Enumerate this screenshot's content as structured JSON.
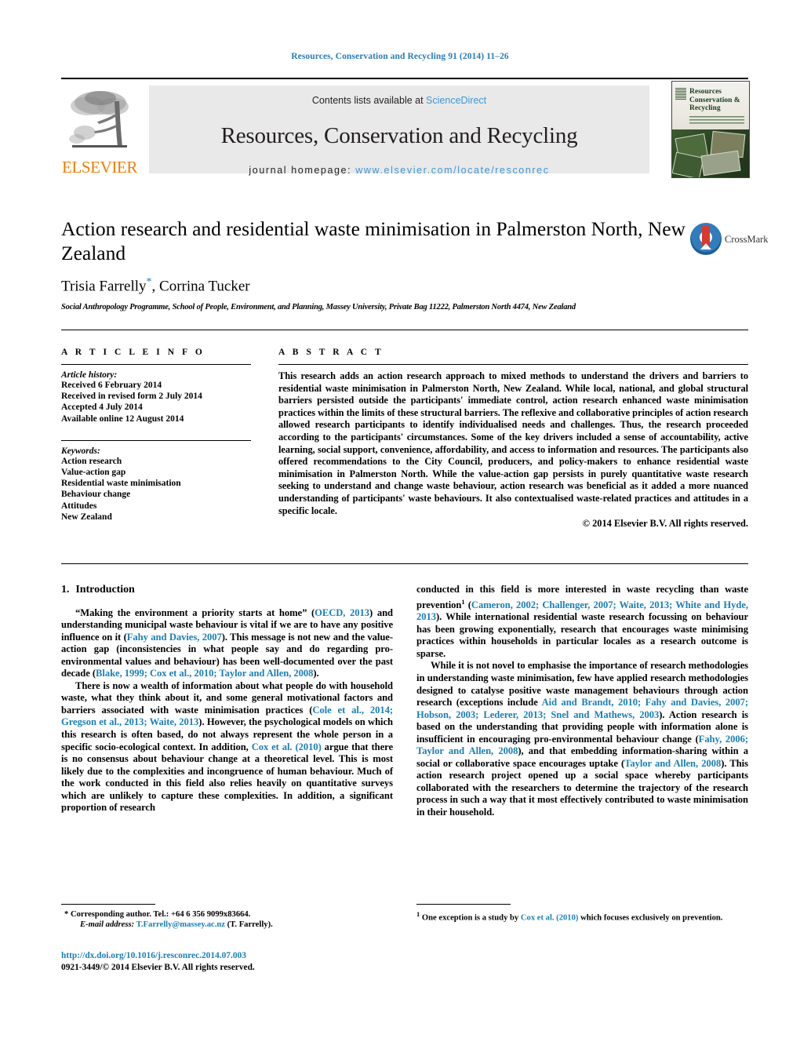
{
  "running_head": "Resources, Conservation and Recycling 91 (2014) 11–26",
  "masthead": {
    "contents_prefix": "Contents lists available at ",
    "sciencedirect": "ScienceDirect",
    "journal_title": "Resources, Conservation and Recycling",
    "homepage_label": "journal homepage: ",
    "homepage_url": "www.elsevier.com/locate/resconrec",
    "publisher": "ELSEVIER",
    "cover_title": "Resources Conservation & Recycling",
    "accent_blue": "#3f97d3",
    "elsevier_orange": "#ef7d00"
  },
  "title_block": {
    "title": "Action research and residential waste minimisation in Palmerston North, New Zealand",
    "authors": "Trisia Farrelly",
    "authors_rest": ", Corrina Tucker",
    "corresponding_marker": "*",
    "affiliation": "Social Anthropology Programme, School of People, Environment, and Planning, Massey University, Private Bag 11222, Palmerston North 4474, New Zealand",
    "crossmark_label": "CrossMark"
  },
  "article_info": {
    "heading": "A R T I C L E    I N F O",
    "history_label": "Article history:",
    "history": [
      "Received 6 February 2014",
      "Received in revised form 2 July 2014",
      "Accepted 4 July 2014",
      "Available online 12 August 2014"
    ],
    "keywords_label": "Keywords:",
    "keywords": [
      "Action research",
      "Value-action gap",
      "Residential waste minimisation",
      "Behaviour change",
      "Attitudes",
      "New Zealand"
    ]
  },
  "abstract": {
    "heading": "A B S T R A C T",
    "text": "This research adds an action research approach to mixed methods to understand the drivers and barriers to residential waste minimisation in Palmerston North, New Zealand. While local, national, and global structural barriers persisted outside the participants' immediate control, action research enhanced waste minimisation practices within the limits of these structural barriers. The reflexive and collaborative principles of action research allowed research participants to identify individualised needs and challenges. Thus, the research proceeded according to the participants' circumstances. Some of the key drivers included a sense of accountability, active learning, social support, convenience, affordability, and access to information and resources. The participants also offered recommendations to the City Council, producers, and policy-makers to enhance residential waste minimisation in Palmerston North. While the value-action gap persists in purely quantitative waste research seeking to understand and change waste behaviour, action research was beneficial as it added a more nuanced understanding of participants' waste behaviours. It also contextualised waste-related practices and attitudes in a specific locale.",
    "rights": "© 2014 Elsevier B.V. All rights reserved."
  },
  "introduction": {
    "number": "1.",
    "heading": "Introduction",
    "left_p1_a": "“Making the environment a priority starts at home” (",
    "left_p1_ref1": "OECD, 2013",
    "left_p1_b": ") and understanding municipal waste behaviour is vital if we are to have any positive influence on it (",
    "left_p1_ref2": "Fahy and Davies, 2007",
    "left_p1_c": "). This message is not new and the value-action gap (inconsistencies in what people say and do regarding pro-environmental values and behaviour) has been well-documented over the past decade (",
    "left_p1_ref3": "Blake, 1999; Cox et al., 2010; Taylor and Allen, 2008",
    "left_p1_d": ").",
    "left_p2_a": "There is now a wealth of information about what people do with household waste, what they think about it, and some general motivational factors and barriers associated with waste minimisation practices (",
    "left_p2_ref1": "Cole et al., 2014; Gregson et al., 2013; Waite, 2013",
    "left_p2_b": "). However, the psychological models on which this research is often based, do not always represent the whole person in a specific socio-ecological context. In addition, ",
    "left_p2_ref2": "Cox et al. (2010)",
    "left_p2_c": " argue that there is no consensus about behaviour change at a theoretical level. This is most likely due to the complexities and incongruence of human behaviour. Much of the work conducted in this field also relies heavily on quantitative surveys which are unlikely to capture these complexities. In addition, a significant proportion of research",
    "right_p1_a": "conducted in this field is more interested in waste recycling than waste prevention",
    "right_p1_fn": "1",
    "right_p1_b": " (",
    "right_p1_ref1": "Cameron, 2002; Challenger, 2007; Waite, 2013; White and Hyde, 2013",
    "right_p1_c": "). While international residential waste research focussing on behaviour has been growing exponentially, research that encourages waste minimising practices within households in particular locales as a research outcome is sparse.",
    "right_p2_a": "While it is not novel to emphasise the importance of research methodologies in understanding waste minimisation, few have applied research methodologies designed to catalyse positive waste management behaviours through action research (exceptions include ",
    "right_p2_ref1": "Aid and Brandt, 2010; Fahy and Davies, 2007; Hobson, 2003; Lederer, 2013; Snel and Mathews, 2003",
    "right_p2_b": "). Action research is based on the understanding that providing people with information alone is insufficient in encouraging pro-environmental behaviour change (",
    "right_p2_ref2": "Fahy, 2006; Taylor and Allen, 2008",
    "right_p2_c": "), and that embedding information-sharing within a social or collaborative space encourages uptake (",
    "right_p2_ref3": "Taylor and Allen, 2008",
    "right_p2_d": "). This action research project opened up a social space whereby participants collaborated with the researchers to determine the trajectory of the research process in such a way that it most effectively contributed to waste minimisation in their household."
  },
  "footnotes": {
    "left_marker": "*",
    "left_line1": " Corresponding author. Tel.: +64 6 356 9099x83664.",
    "left_email_label": "E-mail address:",
    "left_email": "T.Farrelly@massey.ac.nz",
    "left_email_tail": " (T. Farrelly).",
    "right_marker": "1",
    "right_a": " One exception is a study by ",
    "right_ref": "Cox et al. (2010)",
    "right_b": " which focuses exclusively on prevention."
  },
  "imprint": {
    "doi": "http://dx.doi.org/10.1016/j.resconrec.2014.07.003",
    "issn_line": "0921-3449/© 2014 Elsevier B.V. All rights reserved."
  }
}
